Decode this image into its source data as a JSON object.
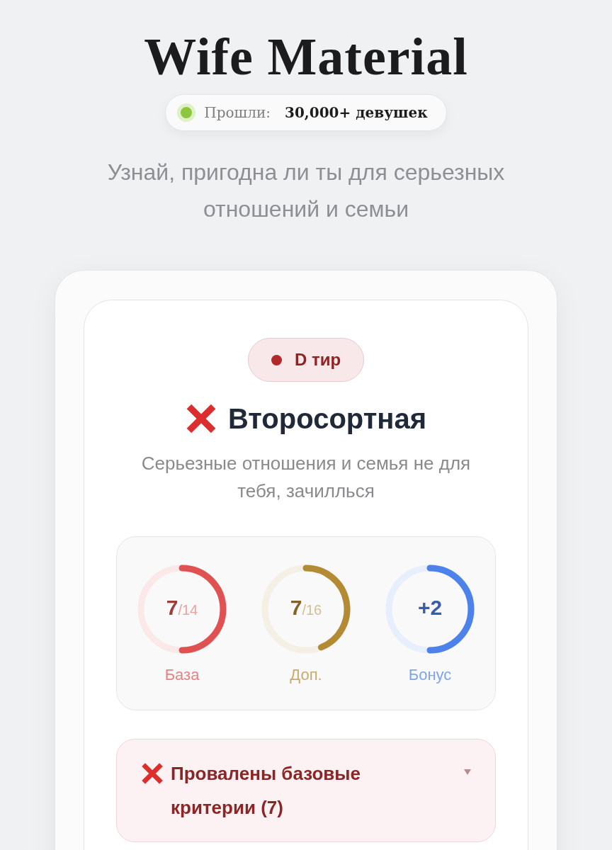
{
  "header": {
    "title": "Wife Material",
    "badge": {
      "label": "Прошли:",
      "value": "30,000+ девушек"
    },
    "subtitle": "Узнай, пригодна ли ты для серьезных отношений и семьи"
  },
  "result": {
    "tier": "D тир",
    "verdict": "Второсортная",
    "description": "Серьезные отношения и семья не для тебя, зачиллься"
  },
  "scores": [
    {
      "value": "7",
      "total": "/14",
      "label": "База",
      "level": 0.5,
      "color": "#e05252"
    },
    {
      "value": "7",
      "total": "/16",
      "label": "Доп.",
      "level": 0.44,
      "color": "#b38b34"
    },
    {
      "value": "+2",
      "label": "Бонус",
      "level": 0.5,
      "color": "#4c82ea"
    }
  ],
  "sections": [
    {
      "title": "Провалены базовые критерии (7)",
      "expanded": false
    }
  ]
}
